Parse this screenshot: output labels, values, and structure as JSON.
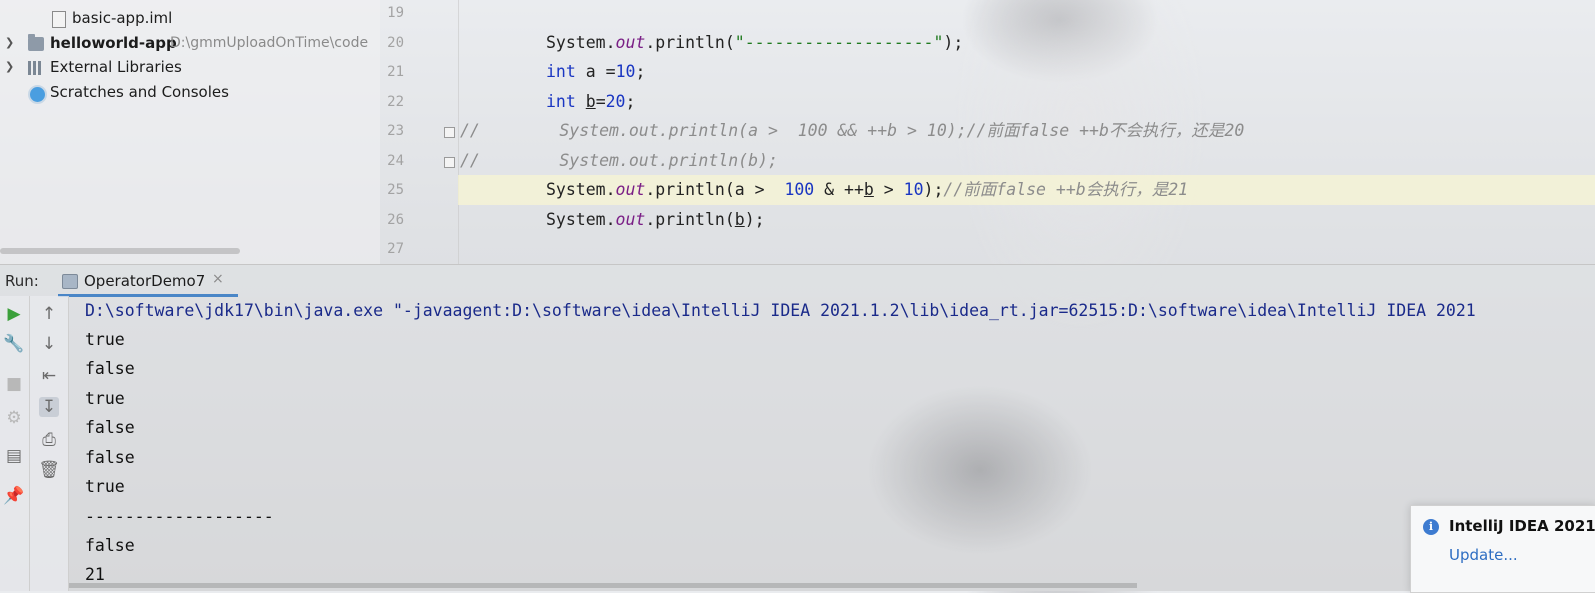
{
  "project_tree": {
    "items": [
      {
        "label": "basic-app.iml",
        "type": "file"
      },
      {
        "label": "helloworld-app",
        "path": "D:\\gmmUploadOnTime\\code",
        "type": "module"
      },
      {
        "label": "External Libraries",
        "type": "libraries"
      },
      {
        "label": "Scratches and Consoles",
        "type": "scratches"
      }
    ]
  },
  "editor": {
    "line_numbers": [
      "19",
      "20",
      "21",
      "22",
      "23",
      "24",
      "25",
      "26",
      "27"
    ],
    "lines": {
      "l20": {
        "a": "System.",
        "b": "out",
        "c": ".println(",
        "d": "\"-------------------\"",
        "e": ");"
      },
      "l21": {
        "kw": "int",
        "a": " a =",
        "n": "10",
        "e": ";"
      },
      "l22": {
        "kw": "int",
        "sp": " ",
        "v": "b",
        "eq": "=",
        "n": "20",
        "e": ";"
      },
      "l23": {
        "text": "//        System.out.println(a >  100 && ++b > 10);//前面false ++b不会执行，还是20"
      },
      "l24": {
        "text": "//        System.out.println(b);"
      },
      "l25": {
        "a": "System.",
        "b": "out",
        "c": ".println(a >  ",
        "n1": "100",
        "d": " & ++",
        "v": "b",
        "e": " > ",
        "n2": "10",
        "f": ");",
        "comment": "//前面false ++b会执行，是21"
      },
      "l26": {
        "a": "System.",
        "b": "out",
        "c": ".println(",
        "v": "b",
        "e": ");"
      }
    }
  },
  "run": {
    "label": "Run:",
    "tab_label": "OperatorDemo7",
    "tab_close": "×",
    "console_lines": [
      "D:\\software\\jdk17\\bin\\java.exe \"-javaagent:D:\\software\\idea\\IntelliJ IDEA 2021.1.2\\lib\\idea_rt.jar=62515:D:\\software\\idea\\IntelliJ IDEA 2021",
      "true",
      "false",
      "true",
      "false",
      "false",
      "true",
      "-------------------",
      "false",
      "21"
    ]
  },
  "notification": {
    "title": "IntelliJ IDEA 2021",
    "link": "Update..."
  },
  "colors": {
    "keyword": "#1a36c2",
    "field": "#7a1f86",
    "string": "#1f7a1f",
    "comment": "#8c8c8c",
    "accent": "#4a86c7"
  }
}
